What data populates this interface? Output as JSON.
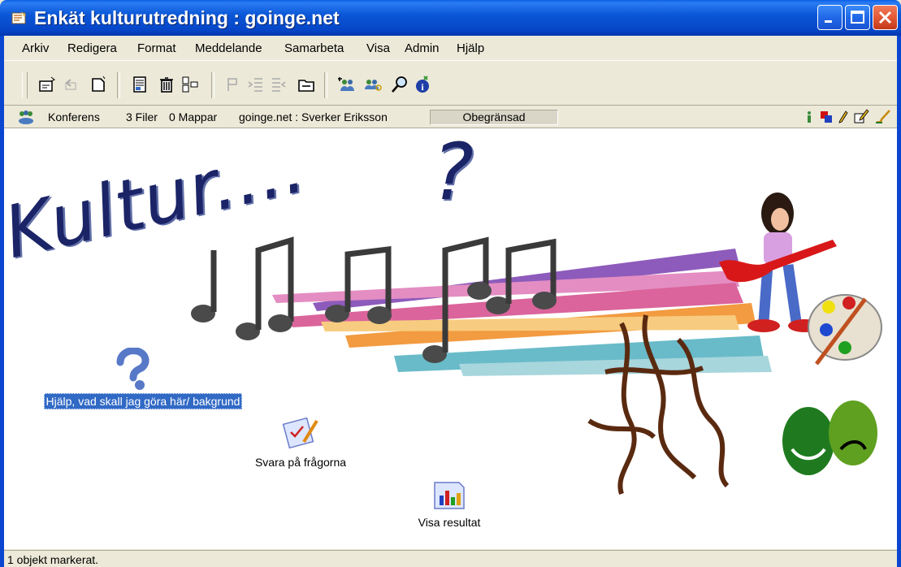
{
  "window": {
    "title": "Enkät kulturutredning : goinge.net",
    "controls": [
      "minimize-icon",
      "maximize-icon",
      "close-icon"
    ]
  },
  "menu": {
    "items": [
      "Arkiv",
      "Redigera",
      "Format",
      "Meddelande",
      "Samarbeta",
      "Visa",
      "Admin",
      "Hjälp"
    ]
  },
  "toolbar": {
    "icons": [
      "new-item-icon",
      "reply-icon",
      "new-document-icon",
      "properties-icon",
      "delete-icon",
      "move-icon",
      "flag-icon",
      "indent-icon",
      "outdent-icon",
      "open-folder-icon",
      "add-users-icon",
      "find-users-icon",
      "search-icon",
      "info-icon"
    ]
  },
  "infobar": {
    "type_label": "Konferens",
    "files": "3 Filer",
    "folders": "0 Mappar",
    "location": "goinge.net : Sverker Eriksson",
    "quota": "Obegränsad",
    "right_icons": [
      "info-icon",
      "windows-icon",
      "pencil-icon",
      "edit-icon",
      "brush-icon"
    ]
  },
  "content": {
    "banner_title": "Kultur....",
    "banner_question": "?",
    "items": [
      {
        "label": "Hjälp, vad skall jag göra här/ bakgrund",
        "icon": "help-question-icon",
        "selected": true
      },
      {
        "label": "Svara på frågorna",
        "icon": "survey-form-icon",
        "selected": false
      },
      {
        "label": "Visa resultat",
        "icon": "results-chart-icon",
        "selected": false
      }
    ]
  },
  "status": {
    "text": "1 objekt markerat."
  },
  "colors": {
    "titlebar": "#0A5FE6",
    "chrome": "#ECE9D8",
    "selection": "#316AC5",
    "banner_text": "#1B2466"
  }
}
